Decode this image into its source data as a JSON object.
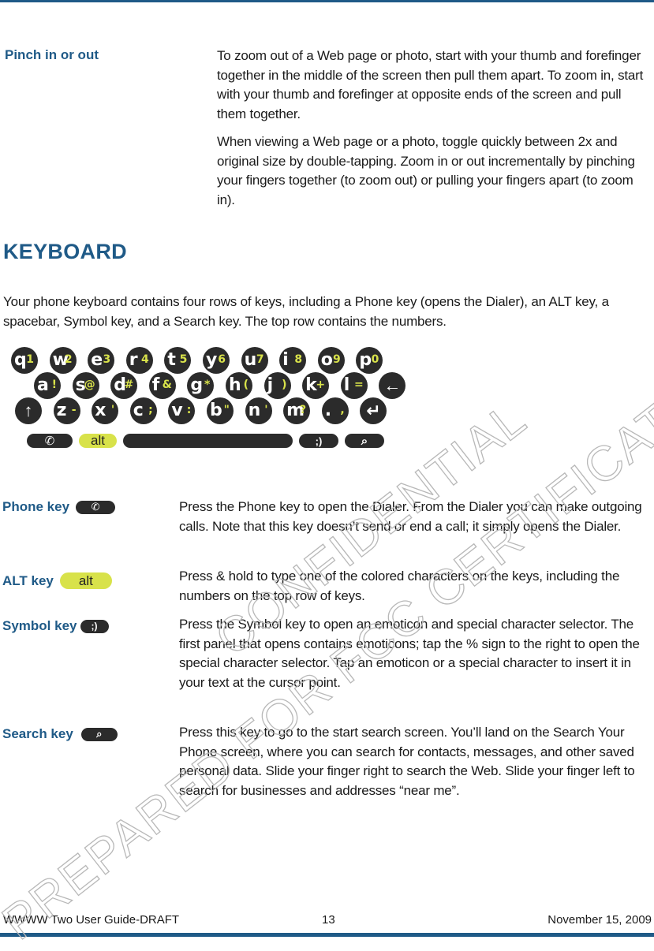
{
  "pinch": {
    "label": "Pinch in or out",
    "paragraphs": [
      "To zoom out of a Web page or photo, start with your thumb and forefinger together in the middle of the screen then pull them apart. To zoom in, start with your thumb and forefinger at opposite ends of the screen and pull them together.",
      "When viewing a Web page or a photo, toggle quickly between 2x and original size by double-tapping. Zoom in or out incrementally by pinching your fingers together (to zoom out) or pulling your fingers apart (to zoom in)."
    ]
  },
  "section": {
    "heading": "KEYBOARD",
    "intro": "Your phone keyboard contains four rows of keys, including a  Phone key (opens the Dialer), an ALT key, a spacebar, Symbol key, and a Search key. The top row contains the numbers."
  },
  "keyboard": {
    "row1": [
      {
        "main": "q",
        "alt": "1"
      },
      {
        "main": "w",
        "alt": "2"
      },
      {
        "main": "e",
        "alt": "3"
      },
      {
        "main": "r",
        "alt": "4"
      },
      {
        "main": "t",
        "alt": "5"
      },
      {
        "main": "y",
        "alt": "6"
      },
      {
        "main": "u",
        "alt": "7"
      },
      {
        "main": "i",
        "alt": "8"
      },
      {
        "main": "o",
        "alt": "9"
      },
      {
        "main": "p",
        "alt": "0"
      }
    ],
    "row2": [
      {
        "main": "a",
        "alt": "!"
      },
      {
        "main": "s",
        "alt": "@"
      },
      {
        "main": "d",
        "alt": "#"
      },
      {
        "main": "f",
        "alt": "&"
      },
      {
        "main": "g",
        "alt": "*"
      },
      {
        "main": "h",
        "alt": "("
      },
      {
        "main": "j",
        "alt": ")"
      },
      {
        "main": "k",
        "alt": "+"
      },
      {
        "main": "l",
        "alt": "="
      },
      {
        "main": "←",
        "alt": ""
      }
    ],
    "row3": [
      {
        "main": "↑",
        "alt": ""
      },
      {
        "main": "z",
        "alt": "-"
      },
      {
        "main": "x",
        "alt": "'"
      },
      {
        "main": "c",
        "alt": ";"
      },
      {
        "main": "v",
        "alt": ":"
      },
      {
        "main": "b",
        "alt": "\""
      },
      {
        "main": "n",
        "alt": "'"
      },
      {
        "main": "m",
        "alt": "?"
      },
      {
        "main": ".",
        "alt": ","
      },
      {
        "main": "↵",
        "alt": ""
      }
    ],
    "bottom": {
      "phone_icon": "✆",
      "alt_label": "alt",
      "symbol_label": ";)",
      "search_icon": "⌕"
    }
  },
  "keys": [
    {
      "label": "Phone key",
      "icon": "✆",
      "description": "Press the Phone key to open the Dialer. From the Dialer you can make outgoing calls. Note that this key doesn’t send or end a call; it simply opens the Dialer."
    },
    {
      "label": "ALT key",
      "icon": "alt",
      "description": "Press & hold to type one of the colored characters on the keys, including the numbers on the top row of keys."
    },
    {
      "label": "Symbol key",
      "icon": ";)",
      "description": "Press the Symbol key to open an emoticon and special character selector. The first panel that opens contains emoticons; tap the % sign to the right to open the special character selector. Tap an emoticon or a special character to insert it in your text at the cursor point."
    },
    {
      "label": "Search key",
      "icon": "⌕",
      "description": "Press this key to go to the start search screen. You’ll land on the Search Your Phone screen, where you can search for contacts, messages, and other saved personal data. Slide your finger right to search the Web. Slide your finger left to search for businesses and addresses “near me”."
    }
  ],
  "footer": {
    "title": "WWWW Two User Guide-DRAFT",
    "page": "13",
    "date": "November 15, 2009"
  },
  "watermark": {
    "line1": "PREPARED FOR FCC CERTIFICATION",
    "line2": "CONFIDENTIAL"
  },
  "colors": {
    "brand_blue": "#1f5a87",
    "key_dark": "#2b2b2b",
    "alt_yellow": "#d8e24a"
  }
}
